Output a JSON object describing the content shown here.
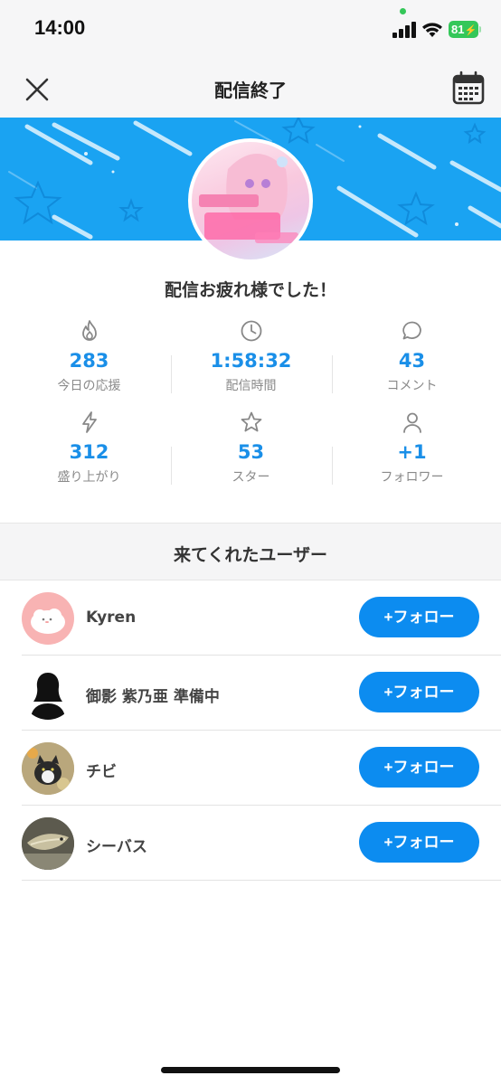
{
  "status_bar": {
    "time": "14:00",
    "battery": "81"
  },
  "nav": {
    "title": "配信終了",
    "close_icon": "close-icon",
    "calendar_icon": "calendar-icon"
  },
  "greeting": "配信お疲れ様でした！",
  "stats": [
    {
      "icon": "flame-icon",
      "value": "283",
      "label": "今日の応援"
    },
    {
      "icon": "clock-icon",
      "value": "1:58:32",
      "label": "配信時間"
    },
    {
      "icon": "comment-icon",
      "value": "43",
      "label": "コメント"
    },
    {
      "icon": "lightning-icon",
      "value": "312",
      "label": "盛り上がり"
    },
    {
      "icon": "star-icon",
      "value": "53",
      "label": "スター"
    },
    {
      "icon": "person-icon",
      "value": "+1",
      "label": "フォロワー"
    }
  ],
  "users_section": {
    "title": "来てくれたユーザー",
    "users": [
      {
        "name": "Kyren",
        "follow_label": "+フォロー"
      },
      {
        "name": "御影 紫乃亜 準備中",
        "follow_label": "+フォロー"
      },
      {
        "name": "チビ",
        "follow_label": "+フォロー"
      },
      {
        "name": "シーバス",
        "follow_label": "+フォロー"
      }
    ]
  },
  "colors": {
    "accent": "#1a8fe8",
    "button": "#0c8cf0",
    "banner": "#1aa3f2",
    "battery": "#34c759"
  }
}
